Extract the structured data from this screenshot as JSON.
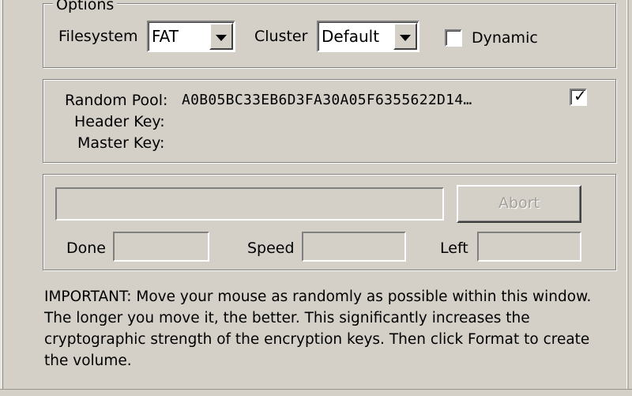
{
  "options": {
    "legend": "Options",
    "filesystem_label": "Filesystem",
    "filesystem_value": "FAT",
    "cluster_label": "Cluster",
    "cluster_value": "Default",
    "dynamic_label": "Dynamic",
    "dynamic_checked": false
  },
  "keys": {
    "random_pool_label": "Random Pool:",
    "random_pool_value": "A0B05BC33EB6D3FA30A05F6355622D14…",
    "random_pool_checkbox_checked": true,
    "header_key_label": "Header Key:",
    "header_key_value": "",
    "master_key_label": "Master Key:",
    "master_key_value": ""
  },
  "progress": {
    "abort_label": "Abort",
    "done_label": "Done",
    "done_value": "",
    "speed_label": "Speed",
    "speed_value": "",
    "left_label": "Left",
    "left_value": ""
  },
  "important_text": "IMPORTANT: Move your mouse as randomly as possible within this window. The longer you move it, the better. This significantly increases the cryptographic strength of the encryption keys. Then click Format to create the volume."
}
